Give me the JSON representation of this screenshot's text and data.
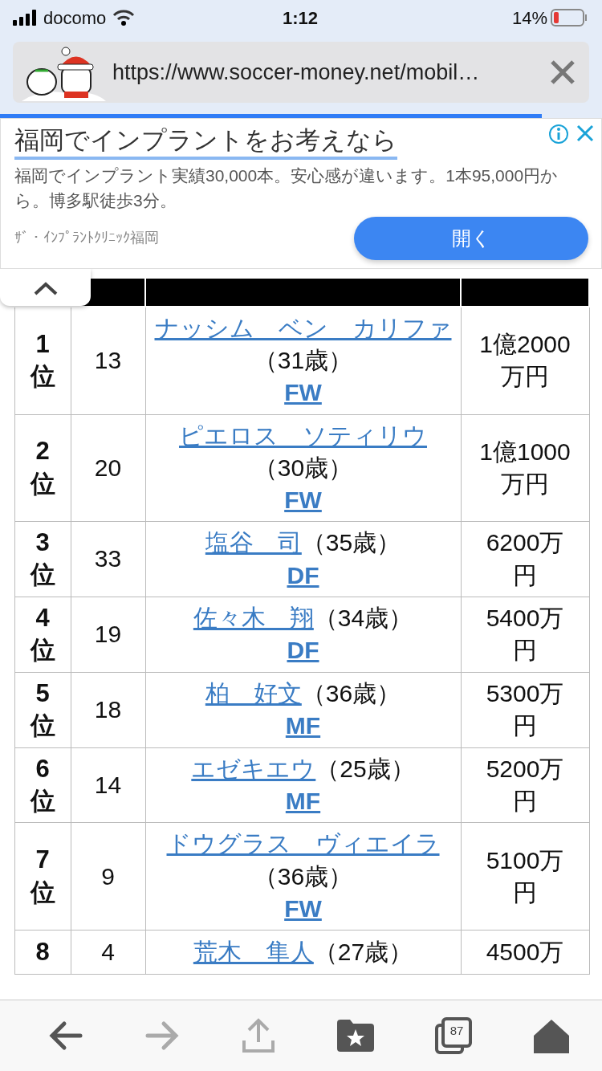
{
  "status_bar": {
    "carrier": "docomo",
    "time": "1:12",
    "battery": "14%"
  },
  "address_bar": {
    "url": "https://www.soccer-money.net/mobil…"
  },
  "page_load": {
    "level": 0.9
  },
  "ad": {
    "title": "福岡でインプラントをお考えなら",
    "description": "福岡でインプラント実績30,000本。安心感が違います。1本95,000円から。博多駅徒歩3分。",
    "advertiser": "ｻﾞ・ｲﾝﾌﾟﾗﾝﾄｸﾘﾆｯｸ福岡",
    "button": "開く"
  },
  "table": {
    "rows": [
      {
        "rank": "1位",
        "number": "13",
        "name": "ナッシム　ベン　カリファ",
        "age": "（31歳）",
        "position": "FW",
        "salary": "1億2000万円"
      },
      {
        "rank": "2位",
        "number": "20",
        "name": "ピエロス　ソティリウ",
        "age": "（30歳）",
        "position": "FW",
        "salary": "1億1000万円"
      },
      {
        "rank": "3位",
        "number": "33",
        "name": "塩谷　司",
        "age": "（35歳）",
        "position": "DF",
        "salary": "6200万円"
      },
      {
        "rank": "4位",
        "number": "19",
        "name": "佐々木　翔",
        "age": "（34歳）",
        "position": "DF",
        "salary": "5400万円"
      },
      {
        "rank": "5位",
        "number": "18",
        "name": "柏　好文",
        "age": "（36歳）",
        "position": "MF",
        "salary": "5300万円"
      },
      {
        "rank": "6位",
        "number": "14",
        "name": "エゼキエウ",
        "age": "（25歳）",
        "position": "MF",
        "salary": "5200万円"
      },
      {
        "rank": "7位",
        "number": "9",
        "name": "ドウグラス　ヴィエイラ",
        "age": "（36歳）",
        "position": "FW",
        "salary": "5100万円"
      },
      {
        "rank": "8",
        "number": "4",
        "name": "荒木　隼人",
        "age": "（27歳）",
        "salary": "4500万"
      }
    ]
  },
  "toolbar": [
    {
      "kind": "back",
      "disabled": false
    },
    {
      "kind": "forward",
      "disabled": true
    },
    {
      "kind": "share",
      "disabled": true
    },
    {
      "kind": "bookmarks",
      "disabled": false
    },
    {
      "kind": "tabs",
      "disabled": false,
      "count": "87"
    },
    {
      "kind": "home",
      "disabled": false
    }
  ]
}
